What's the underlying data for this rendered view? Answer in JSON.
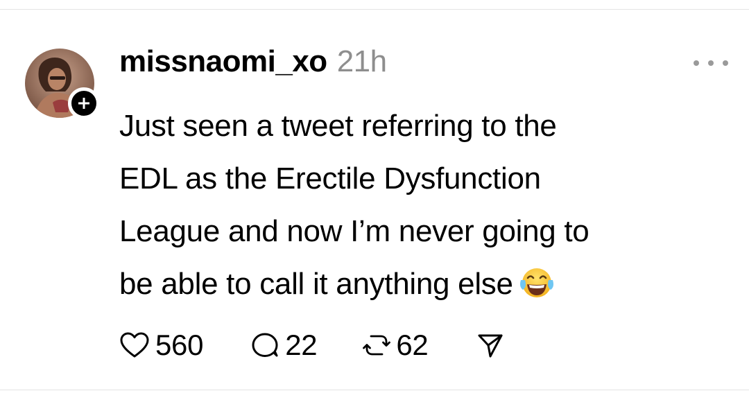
{
  "post": {
    "author": {
      "username": "missnaomi_xo",
      "avatar": "profile-photo",
      "follow_icon": "plus-icon"
    },
    "timestamp": "21h",
    "more_icon": "ellipsis-icon",
    "text_lines": [
      "Just seen a tweet referring to the",
      "EDL as the Erectile Dysfunction",
      "League and now I’m never going to",
      "be able to call it anything else"
    ],
    "emoji": "face-with-tears-of-joy",
    "actions": {
      "likes": {
        "icon": "heart-icon",
        "count": "560"
      },
      "replies": {
        "icon": "comment-icon",
        "count": "22"
      },
      "reposts": {
        "icon": "repost-icon",
        "count": "62"
      },
      "share": {
        "icon": "send-icon"
      }
    }
  },
  "colors": {
    "text": "#000000",
    "muted": "#8e8e8e",
    "divider": "#e3e3e3",
    "background": "#ffffff"
  }
}
